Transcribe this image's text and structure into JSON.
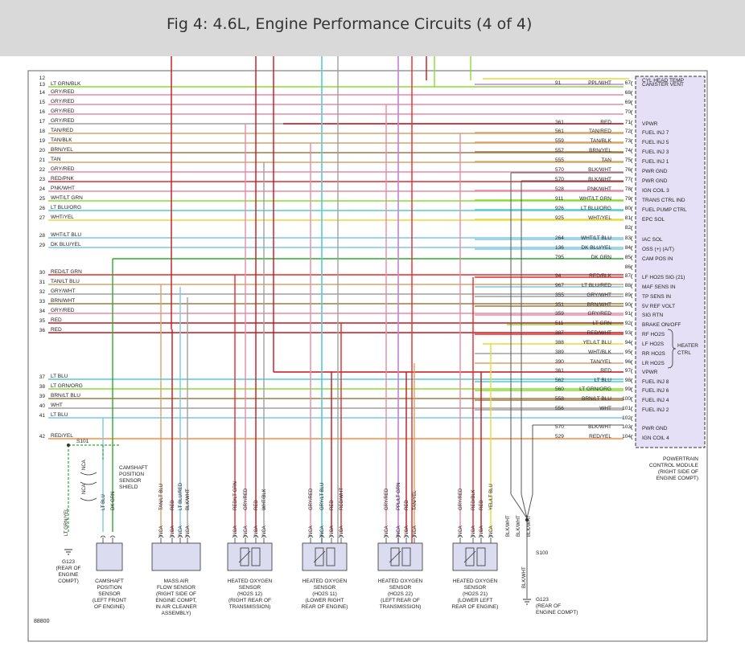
{
  "title": "Fig 4: 4.6L, Engine Performance Circuits (4 of 4)",
  "figure_number": "88800",
  "colors": {
    "red": "#e52b2b",
    "dark_red": "#c8151b",
    "green": "#2eaa2e",
    "lt_green": "#88dd33",
    "cyan": "#55ccd6",
    "lt_blue": "#7cc9e8",
    "pink": "#e88aa6",
    "gray": "#a0a0a0",
    "tan": "#d7a469",
    "yellow": "#e6dc3a",
    "brown": "#9e7a45",
    "purple": "#c583d6",
    "orange": "#ff8a3a",
    "pcm_fill": "#e6e0f6",
    "sensor_fill": "#dcdcf0"
  },
  "left_wires": [
    {
      "pin": "12",
      "label": ""
    },
    {
      "pin": "13",
      "label": "LT GRN/BLK"
    },
    {
      "pin": "14",
      "label": "GRY/RED"
    },
    {
      "pin": "15",
      "label": "GRY/RED"
    },
    {
      "pin": "16",
      "label": "GRY/RED"
    },
    {
      "pin": "17",
      "label": "GRY/RED"
    },
    {
      "pin": "18",
      "label": "TAN/RED"
    },
    {
      "pin": "19",
      "label": "TAN/BLK"
    },
    {
      "pin": "20",
      "label": "BRN/YEL"
    },
    {
      "pin": "21",
      "label": "TAN"
    },
    {
      "pin": "22",
      "label": "GRY/RED"
    },
    {
      "pin": "23",
      "label": "RED/PNK"
    },
    {
      "pin": "24",
      "label": "PNK/WHT"
    },
    {
      "pin": "25",
      "label": "WHT/LT GRN"
    },
    {
      "pin": "26",
      "label": "LT BLU/ORG"
    },
    {
      "pin": "27",
      "label": "WHT/YEL"
    },
    {
      "pin": "28",
      "label": "WHT/LT BLU"
    },
    {
      "pin": "29",
      "label": "DK BLU/YEL"
    },
    {
      "pin": "30",
      "label": "RED/LT GRN"
    },
    {
      "pin": "31",
      "label": "TAN/LT BLU"
    },
    {
      "pin": "32",
      "label": "GRY/WHT"
    },
    {
      "pin": "33",
      "label": "BRN/WHT"
    },
    {
      "pin": "34",
      "label": "GRY/RED"
    },
    {
      "pin": "35",
      "label": "RED"
    },
    {
      "pin": "36",
      "label": "RED"
    },
    {
      "pin": "37",
      "label": "LT BLU"
    },
    {
      "pin": "38",
      "label": "LT GRN/ORG"
    },
    {
      "pin": "39",
      "label": "BRN/LT BLU"
    },
    {
      "pin": "40",
      "label": "WHT"
    },
    {
      "pin": "41",
      "label": "LT BLU"
    },
    {
      "pin": "42",
      "label": "RED/YEL"
    }
  ],
  "pcm_pins": [
    {
      "pin": "67",
      "circuit": "91",
      "wire": "PPL/WHT",
      "function": "CANISTER VENT"
    },
    {
      "pin": "68",
      "circuit": "",
      "wire": "",
      "function": ""
    },
    {
      "pin": "69",
      "circuit": "",
      "wire": "",
      "function": ""
    },
    {
      "pin": "70",
      "circuit": "",
      "wire": "",
      "function": ""
    },
    {
      "pin": "71",
      "circuit": "361",
      "wire": "RED",
      "function": "VPWR"
    },
    {
      "pin": "72",
      "circuit": "561",
      "wire": "TAN/RED",
      "function": "FUEL INJ 7"
    },
    {
      "pin": "73",
      "circuit": "559",
      "wire": "TAN/BLK",
      "function": "FUEL INJ 5"
    },
    {
      "pin": "74",
      "circuit": "557",
      "wire": "BRN/YEL",
      "function": "FUEL INJ 3"
    },
    {
      "pin": "75",
      "circuit": "555",
      "wire": "TAN",
      "function": "FUEL INJ 1"
    },
    {
      "pin": "76",
      "circuit": "570",
      "wire": "BLK/WHT",
      "function": "PWR GND"
    },
    {
      "pin": "77",
      "circuit": "570",
      "wire": "BLK/WHT",
      "function": "PWR GND"
    },
    {
      "pin": "78",
      "circuit": "528",
      "wire": "PNK/WHT",
      "function": "IGN COIL 3"
    },
    {
      "pin": "79",
      "circuit": "911",
      "wire": "WHT/LT GRN",
      "function": "TRANS CTRL IND"
    },
    {
      "pin": "80",
      "circuit": "926",
      "wire": "LT BLU/ORG",
      "function": "FUEL PUMP CTRL"
    },
    {
      "pin": "81",
      "circuit": "925",
      "wire": "WHT/YEL",
      "function": "EPC SOL"
    },
    {
      "pin": "82",
      "circuit": "",
      "wire": "",
      "function": ""
    },
    {
      "pin": "83",
      "circuit": "264",
      "wire": "WHT/LT BLU",
      "function": "IAC SOL"
    },
    {
      "pin": "84",
      "circuit": "136",
      "wire": "DK BLU/YEL",
      "function": "OSS (+) (A/T)"
    },
    {
      "pin": "85",
      "circuit": "795",
      "wire": "DK GRN",
      "function": "CAM POS IN"
    },
    {
      "pin": "86",
      "circuit": "",
      "wire": "",
      "function": ""
    },
    {
      "pin": "87",
      "circuit": "94",
      "wire": "RED/BLK",
      "function": "LF HO2S SIG (21)"
    },
    {
      "pin": "88",
      "circuit": "967",
      "wire": "LT BLU/RED",
      "function": "MAF SENS IN"
    },
    {
      "pin": "89",
      "circuit": "355",
      "wire": "GRY/WHT",
      "function": "TP SENS IN"
    },
    {
      "pin": "90",
      "circuit": "351",
      "wire": "BRN/WHT",
      "function": "5V REF VOLT"
    },
    {
      "pin": "91",
      "circuit": "359",
      "wire": "GRY/RED",
      "function": "SIG RTN"
    },
    {
      "pin": "92",
      "circuit": "511",
      "wire": "LT GRN",
      "function": "BRAKE ON/OFF"
    },
    {
      "pin": "93",
      "circuit": "387",
      "wire": "RED/WHT",
      "function": "RF HO2S"
    },
    {
      "pin": "94",
      "circuit": "388",
      "wire": "YEL/LT BLU",
      "function": "LF HO2S"
    },
    {
      "pin": "95",
      "circuit": "389",
      "wire": "WHT/BLK",
      "function": "RR HO2S"
    },
    {
      "pin": "96",
      "circuit": "390",
      "wire": "TAN/YEL",
      "function": "LR HO2S"
    },
    {
      "pin": "97",
      "circuit": "361",
      "wire": "RED",
      "function": "VPWR"
    },
    {
      "pin": "98",
      "circuit": "562",
      "wire": "LT BLU",
      "function": "FUEL INJ 8"
    },
    {
      "pin": "99",
      "circuit": "560",
      "wire": "LT GRN/ORG",
      "function": "FUEL INJ 6"
    },
    {
      "pin": "100",
      "circuit": "558",
      "wire": "BRN/LT BLU",
      "function": "FUEL INJ 4"
    },
    {
      "pin": "101",
      "circuit": "556",
      "wire": "WHT",
      "function": "FUEL INJ 2"
    },
    {
      "pin": "102",
      "circuit": "",
      "wire": "",
      "function": ""
    },
    {
      "pin": "103",
      "circuit": "570",
      "wire": "BLK/WHT",
      "function": "PWR GND"
    },
    {
      "pin": "104",
      "circuit": "529",
      "wire": "RED/YEL",
      "function": "IGN COIL 4"
    }
  ],
  "pcm_top_function": "CYL HEAD TEMP",
  "heater_ctrl_label": "HEATER CTRL",
  "pcm_caption": [
    "POWERTRAIN",
    "CONTROL MODULE",
    "(RIGHT SIDE OF",
    "ENGINE COMPT)"
  ],
  "splice_s101": "S101",
  "splice_s100": "S100",
  "shield_label": [
    "CAMSHAFT",
    "POSITION",
    "SENSOR",
    "SHIELD"
  ],
  "nca": "NCA",
  "components": [
    {
      "id": "cmp",
      "pins": [
        "LT BLU",
        "DK GRN"
      ],
      "caption": [
        "CAMSHAFT",
        "POSITION",
        "SENSOR",
        "(LEFT FRONT",
        "OF ENGINE)"
      ]
    },
    {
      "id": "maf",
      "pins": [
        "TAN/LT BLU",
        "RED",
        "LT BLU/RED",
        "BLK/WHT"
      ],
      "caption": [
        "MASS AIR",
        "FLOW SENSOR",
        "(RIGHT SIDE OF",
        "ENGINE COMPT,",
        "IN AIR CLEANER",
        "ASSEMBLY)"
      ]
    },
    {
      "id": "ho2s12",
      "pins": [
        "RED/LT GRN",
        "GRY/RED",
        "RED",
        "WHT/BLK"
      ],
      "caption": [
        "HEATED OXYGEN",
        "SENSOR",
        "(HO2S 12)",
        "(RIGHT REAR OF",
        "TRANSMISSION)"
      ]
    },
    {
      "id": "ho2s11",
      "pins": [
        "GRY/RED",
        "GRY/LT BLU",
        "RED",
        "RED/WHT"
      ],
      "caption": [
        "HEATED OXYGEN",
        "SENSOR",
        "(HO2S 11)",
        "(LOWER RIGHT",
        "REAR OF ENGINE)"
      ]
    },
    {
      "id": "ho2s22",
      "pins": [
        "GRY/RED",
        "PPL/LT GRN",
        "RED",
        "TAN/YEL"
      ],
      "caption": [
        "HEATED OXYGEN",
        "SENSOR",
        "(HO2S 22)",
        "(LEFT REAR OF",
        "TRANSMISSION)"
      ]
    },
    {
      "id": "ho2s21",
      "pins": [
        "GRY/RED",
        "RED/BLK",
        "RED",
        "YEL/LT BLU"
      ],
      "caption": [
        "HEATED OXYGEN",
        "SENSOR",
        "(HO2S 21)",
        "(LOWER LEFT",
        "REAR OF ENGINE)"
      ]
    }
  ],
  "ltgrnyel_label": "LT GRN/YEL",
  "blkwht_label": "BLK/WHT",
  "blkwht_lower_label": "BLK/WHT",
  "ground_g123_left": [
    "G123",
    "(REAR OF",
    "ENGINE",
    "COMPT)"
  ],
  "ground_g123_right": [
    "G123",
    "(REAR OF",
    "ENGINE COMPT)"
  ]
}
